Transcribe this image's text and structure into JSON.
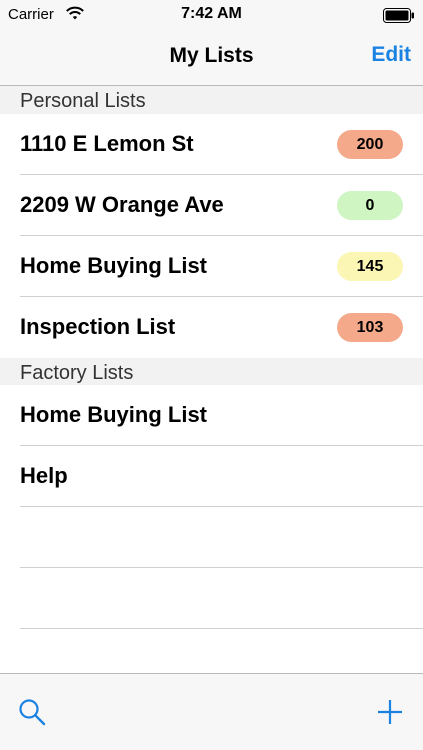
{
  "status": {
    "carrier": "Carrier",
    "time": "7:42 AM"
  },
  "nav": {
    "title": "My Lists",
    "edit_label": "Edit"
  },
  "sections": [
    {
      "title": "Personal Lists",
      "rows": [
        {
          "label": "1110 E Lemon St",
          "badge": "200",
          "badge_color": "#f4a98b"
        },
        {
          "label": "2209 W Orange Ave",
          "badge": "0",
          "badge_color": "#cff5c2"
        },
        {
          "label": "Home Buying List",
          "badge": "145",
          "badge_color": "#fbf6b4"
        },
        {
          "label": "Inspection List",
          "badge": "103",
          "badge_color": "#f4a98b"
        }
      ]
    },
    {
      "title": "Factory Lists",
      "rows": [
        {
          "label": "Home Buying List"
        },
        {
          "label": "Help"
        }
      ]
    }
  ],
  "toolbar": {
    "search_icon": "search-icon",
    "add_icon": "plus-icon"
  },
  "colors": {
    "accent": "#1a82e2"
  }
}
